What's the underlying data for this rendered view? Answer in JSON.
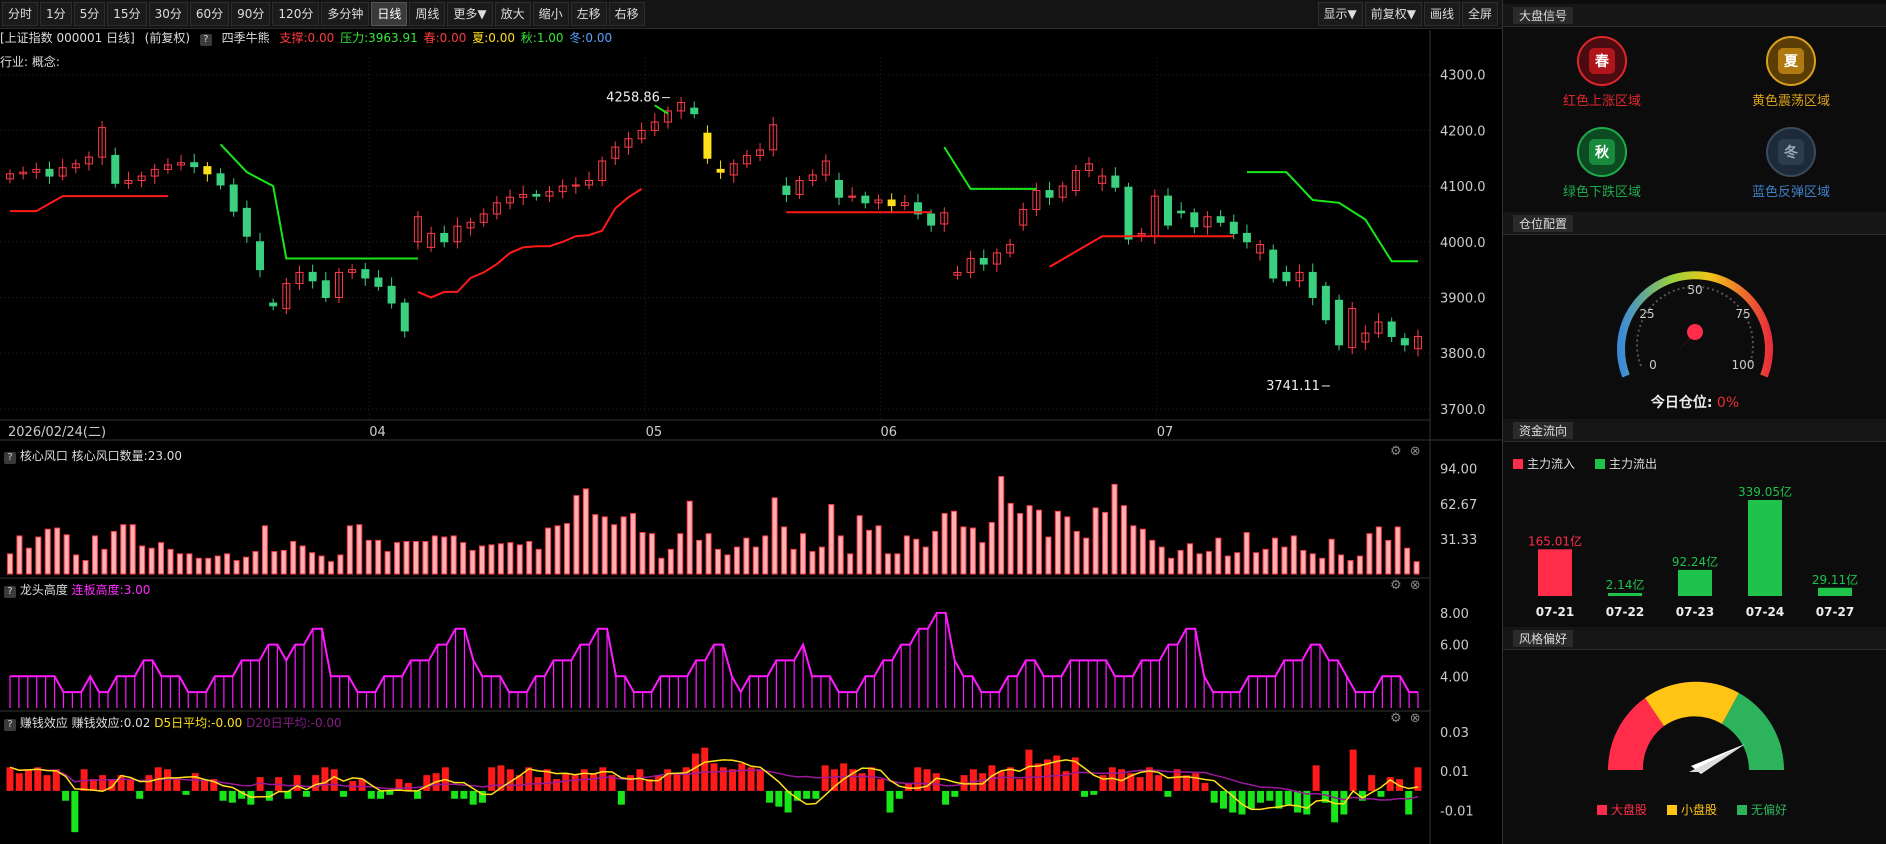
{
  "toolbar": {
    "periods": [
      "分时",
      "1分",
      "5分",
      "15分",
      "30分",
      "60分",
      "90分",
      "120分",
      "多分钟",
      "日线",
      "周线",
      "更多▼",
      "放大",
      "缩小",
      "左移",
      "右移"
    ],
    "active": "日线",
    "right": [
      "显示▼",
      "前复权▼",
      "画线",
      "全屏"
    ]
  },
  "info": {
    "index": "[上证指数 000001 日线]",
    "adjust": "(前复权)",
    "qmark": "?",
    "indicator": "四季牛熊",
    "support": "支撑:0.00",
    "pressure": "压力:3963.91",
    "spring": "春:0.00",
    "summer": "夏:0.00",
    "autumn": "秋:1.00",
    "winter": "冬:0.00"
  },
  "industry": "行业: 概念:",
  "main_chart": {
    "date_label": "2026/02/24(二)",
    "months": [
      {
        "label": "04",
        "i": 26
      },
      {
        "label": "05",
        "i": 46
      },
      {
        "label": "06",
        "i": 63
      },
      {
        "label": "07",
        "i": 83
      }
    ],
    "y_ticks": [
      "4300.0",
      "4200.0",
      "4100.0",
      "4000.0",
      "3900.0",
      "3800.0",
      "3700.0"
    ],
    "y_range": [
      3680,
      4330
    ],
    "high_label": "4258.86",
    "low_label": "3741.11"
  },
  "chart_data": [
    {
      "type": "candlestick",
      "title": "上证指数 000001 日线",
      "ylim": [
        3680,
        4330
      ],
      "x_ticks": [
        "04",
        "05",
        "06",
        "07"
      ],
      "open": [
        4113,
        4122,
        4125,
        4130,
        4118,
        4133,
        4140,
        4152,
        4155,
        4105,
        4110,
        4118,
        4130,
        4138,
        4142,
        4135,
        4122,
        4102,
        4060,
        4000,
        3890,
        3880,
        3925,
        3945,
        3930,
        3900,
        3945,
        3950,
        3935,
        3920,
        3890,
        4000,
        3990,
        4015,
        4000,
        4025,
        4035,
        4050,
        4070,
        4080,
        4085,
        4082,
        4090,
        4100,
        4102,
        4110,
        4150,
        4170,
        4185,
        4200,
        4215,
        4235,
        4240,
        4195,
        4130,
        4120,
        4140,
        4155,
        4165,
        4100,
        4085,
        4110,
        4120,
        4110,
        4080,
        4082,
        4070,
        4075,
        4065,
        4070,
        4050,
        4032,
        3940,
        3945,
        3970,
        3960,
        3980,
        4030,
        4058,
        4092,
        4080,
        4092,
        4128,
        4105,
        4118,
        4098,
        4012,
        4010,
        4082,
        4055,
        4052,
        4027,
        4045,
        4035,
        4015,
        3980,
        3985,
        3945,
        3930,
        3945,
        3920,
        3895,
        3810,
        3820,
        3836,
        3856,
        3826,
        3808
      ],
      "close": [
        4122,
        4125,
        4130,
        4118,
        4133,
        4140,
        4152,
        4205,
        4105,
        4110,
        4118,
        4130,
        4138,
        4142,
        4135,
        4122,
        4102,
        4055,
        4010,
        3950,
        3885,
        3925,
        3945,
        3930,
        3900,
        3945,
        3950,
        3935,
        3920,
        3890,
        3840,
        4045,
        4015,
        4000,
        4028,
        4035,
        4050,
        4070,
        4080,
        4085,
        4082,
        4090,
        4100,
        4102,
        4110,
        4145,
        4170,
        4185,
        4200,
        4215,
        4235,
        4250,
        4230,
        4150,
        4125,
        4140,
        4155,
        4165,
        4210,
        4085,
        4110,
        4120,
        4145,
        4080,
        4082,
        4070,
        4075,
        4065,
        4070,
        4050,
        4030,
        4052,
        3945,
        3970,
        3960,
        3980,
        3995,
        4058,
        4092,
        4080,
        4100,
        4128,
        4140,
        4118,
        4098,
        4005,
        4015,
        4082,
        4030,
        4052,
        4027,
        4045,
        4035,
        4015,
        4000,
        3995,
        3935,
        3930,
        3945,
        3900,
        3860,
        3815,
        3880,
        3836,
        3856,
        3830,
        3815,
        3830
      ]
    },
    {
      "type": "bar",
      "title": "核心风口",
      "y_ticks": [
        "94.00",
        "62.67",
        "31.33"
      ],
      "ylim": [
        0,
        100
      ],
      "values": [
        18,
        34,
        23,
        33,
        40,
        41,
        35,
        17,
        12,
        34,
        22,
        38,
        44,
        44,
        25,
        23,
        28,
        22,
        18,
        18,
        14,
        14,
        16,
        18,
        12,
        15,
        20,
        43,
        20,
        21,
        29,
        25,
        19,
        16,
        11,
        17,
        43,
        44,
        30,
        30,
        20,
        28,
        29,
        29,
        29,
        34,
        33,
        34,
        28,
        21,
        25,
        26,
        27,
        28,
        26,
        29,
        22,
        41,
        43,
        45,
        70,
        76,
        53,
        51,
        44,
        51,
        54,
        37,
        36,
        14,
        22,
        36,
        65,
        30,
        36,
        22,
        17,
        24,
        32,
        24,
        34,
        68,
        42,
        22,
        36,
        20,
        24,
        62,
        34,
        18,
        52,
        39,
        43,
        18,
        18,
        34,
        31,
        24,
        38,
        54,
        56,
        42,
        41,
        28,
        46,
        87,
        63,
        54,
        61,
        57,
        33,
        56,
        51,
        38,
        32,
        59,
        55,
        80,
        61,
        43,
        40,
        30,
        24,
        14,
        21,
        27,
        18,
        20,
        32,
        16,
        19,
        37,
        19,
        22,
        32,
        24,
        34,
        21,
        18,
        14,
        31,
        17,
        12,
        16,
        36,
        42,
        30,
        42,
        23,
        11
      ],
      "values_label": "核心风口数量:23.00"
    },
    {
      "type": "line",
      "title": "龙头高度",
      "y_ticks": [
        "8.00",
        "6.00",
        "4.00"
      ],
      "ylim": [
        2,
        9
      ],
      "values": [
        4,
        4,
        4,
        4,
        4,
        4,
        3,
        3,
        3,
        4,
        3,
        3,
        4,
        4,
        4,
        5,
        5,
        4,
        4,
        4,
        3,
        3,
        3,
        4,
        4,
        4,
        5,
        5,
        5,
        6,
        6,
        5,
        6,
        6,
        7,
        7,
        4,
        4,
        4,
        3,
        3,
        3,
        4,
        4,
        4,
        5,
        5,
        5,
        6,
        6,
        7,
        7,
        5,
        4,
        4,
        4,
        3,
        3,
        3,
        4,
        4,
        5,
        5,
        5,
        6,
        6,
        7,
        7,
        4,
        4,
        3,
        3,
        3,
        4,
        4,
        4,
        4,
        5,
        5,
        6,
        6,
        4,
        3,
        4,
        4,
        4,
        5,
        5,
        5,
        6,
        4,
        4,
        4,
        3,
        3,
        3,
        4,
        4,
        5,
        5,
        6,
        6,
        7,
        7,
        8,
        8,
        5,
        4,
        4,
        3,
        3,
        3,
        4,
        4,
        5,
        5,
        4,
        4,
        4,
        5,
        5,
        5,
        5,
        5,
        4,
        4,
        4,
        5,
        5,
        5,
        6,
        6,
        7,
        7,
        4,
        3,
        3,
        3,
        3,
        4,
        4,
        4,
        4,
        5,
        5,
        5,
        6,
        6,
        5,
        5,
        4,
        3,
        3,
        3,
        4,
        4,
        4,
        3,
        3
      ],
      "values_label": "连板高度:3.00"
    },
    {
      "type": "bar",
      "title": "赚钱效应",
      "y_ticks": [
        "0.03",
        "0.01",
        "-0.01"
      ],
      "ylim": [
        -0.026,
        0.032
      ],
      "values": [
        0.012,
        0.009,
        0.011,
        0.012,
        0.008,
        0.011,
        -0.005,
        -0.021,
        0.011,
        0.006,
        0.008,
        0.006,
        0.008,
        0.006,
        -0.004,
        0.008,
        0.012,
        0.011,
        0.006,
        -0.002,
        0.009,
        0.005,
        0.006,
        -0.005,
        -0.006,
        -0.004,
        -0.007,
        0.007,
        -0.005,
        0.007,
        -0.004,
        0.008,
        -0.003,
        0.008,
        0.012,
        0.011,
        -0.003,
        0.005,
        0.006,
        -0.004,
        -0.004,
        -0.002,
        0.006,
        0.004,
        -0.004,
        0.008,
        0.009,
        0.012,
        -0.004,
        -0.004,
        -0.007,
        -0.006,
        0.012,
        0.013,
        0.011,
        0.008,
        0.012,
        0.007,
        0.011,
        0.006,
        0.009,
        0.008,
        0.011,
        0.009,
        0.012,
        0.008,
        -0.007,
        0.008,
        0.011,
        0.006,
        0.008,
        0.011,
        0.009,
        0.012,
        0.019,
        0.022,
        0.014,
        0.012,
        0.011,
        0.014,
        0.012,
        0.011,
        -0.006,
        -0.008,
        -0.011,
        -0.005,
        -0.004,
        -0.004,
        0.013,
        0.011,
        0.014,
        0.011,
        0.009,
        0.012,
        0.006,
        -0.011,
        -0.004,
        0.004,
        0.012,
        0.011,
        0.009,
        -0.007,
        -0.003,
        0.008,
        0.011,
        0.009,
        0.013,
        0.01,
        0.012,
        0.006,
        0.021,
        0.014,
        0.016,
        0.018,
        0.01,
        0.017,
        -0.003,
        -0.002,
        0.008,
        0.012,
        0.011,
        0.009,
        0.007,
        0.012,
        0.008,
        -0.003,
        0.011,
        0.008,
        0.009,
        0.004,
        -0.006,
        -0.009,
        -0.011,
        -0.012,
        -0.009,
        -0.006,
        -0.005,
        -0.009,
        -0.007,
        -0.011,
        -0.012,
        0.013,
        -0.006,
        -0.016,
        -0.012,
        0.021,
        -0.005,
        0.008,
        -0.003,
        0.007,
        0.006,
        -0.012,
        0.012
      ],
      "label": "赚钱效应:0.02",
      "d5": "D5日平均:-0.00",
      "d20": "D20日平均:-0.00"
    }
  ],
  "panels": {
    "p1": {
      "qmark": "?",
      "title": "核心风口",
      "value": "核心风口数量:23.00"
    },
    "p2": {
      "qmark": "?",
      "title": "龙头高度",
      "value": "连板高度:3.00"
    },
    "p3": {
      "qmark": "?",
      "title": "赚钱效应",
      "value": "赚钱效应:0.02",
      "d5": "D5日平均:-0.00",
      "d20": "D20日平均:-0.00"
    }
  },
  "sidebar": {
    "signal_title": "大盘信号",
    "signals": [
      {
        "glyph": "春",
        "label": "红色上涨区域",
        "color": "#e0262d"
      },
      {
        "glyph": "夏",
        "label": "黄色震荡区域",
        "color": "#d9a11b"
      },
      {
        "glyph": "秋",
        "label": "绿色下跌区域",
        "color": "#1faa4c"
      },
      {
        "glyph": "冬",
        "label": "蓝色反弹区域",
        "color": "#3f7fc7"
      }
    ],
    "position_title": "仓位配置",
    "gauge_ticks": [
      "0",
      "25",
      "50",
      "75",
      "100"
    ],
    "position_label": "今日仓位:",
    "position_value": "0%",
    "position_fraction": 0.0,
    "flow_title": "资金流向",
    "flow_in_label": "主力流入",
    "flow_out_label": "主力流出",
    "flows": [
      {
        "date": "07-21",
        "value": "165.01亿",
        "amount": 165.01,
        "dir": "in"
      },
      {
        "date": "07-22",
        "value": "2.14亿",
        "amount": 2.14,
        "dir": "out"
      },
      {
        "date": "07-23",
        "value": "92.24亿",
        "amount": 92.24,
        "dir": "out"
      },
      {
        "date": "07-24",
        "value": "339.05亿",
        "amount": 339.05,
        "dir": "out"
      },
      {
        "date": "07-27",
        "value": "29.11亿",
        "amount": 29.11,
        "dir": "out"
      }
    ],
    "style_title": "风格偏好",
    "style_legend": [
      "大盘股",
      "小盘股",
      "无偏好"
    ]
  }
}
